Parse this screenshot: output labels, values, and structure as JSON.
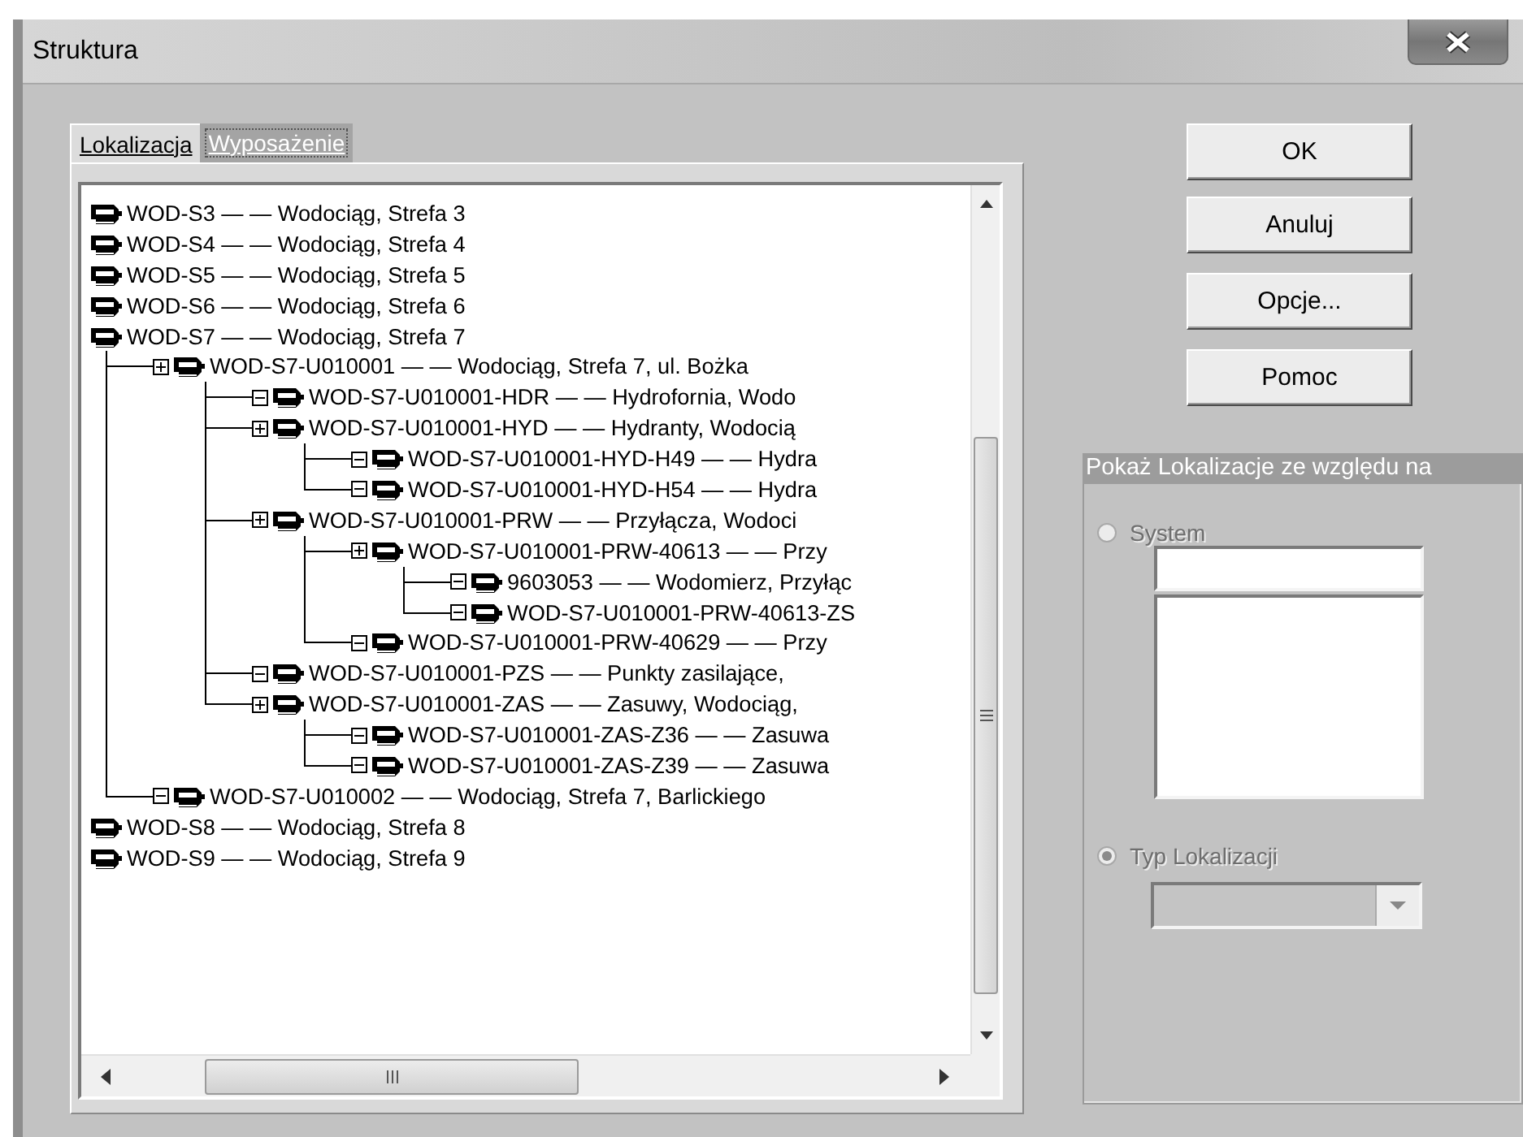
{
  "window": {
    "title": "Struktura"
  },
  "tabs": [
    {
      "label": "Lokalizacja",
      "selected": true
    },
    {
      "label": "Wyposażenie",
      "selected": false
    }
  ],
  "tree": [
    {
      "text": "WOD-S3 — — Wodociąg, Strefa 3"
    },
    {
      "text": "WOD-S4 — — Wodociąg, Strefa 4"
    },
    {
      "text": "WOD-S5 — — Wodociąg, Strefa 5"
    },
    {
      "text": "WOD-S6 — — Wodociąg, Strefa 6"
    },
    {
      "text": "WOD-S7 — — Wodociąg, Strefa 7",
      "children": [
        {
          "text": "WOD-S7-U010001 — — Wodociąg, Strefa 7, ul. Bożka",
          "expanded": false,
          "children": [
            {
              "text": "WOD-S7-U010001-HDR — — Hydrofornia, Wodo",
              "expanded": true
            },
            {
              "text": "WOD-S7-U010001-HYD — — Hydranty, Wodocią",
              "expanded": false,
              "children": [
                {
                  "text": "WOD-S7-U010001-HYD-H49 — — Hydra",
                  "expanded": true
                },
                {
                  "text": "WOD-S7-U010001-HYD-H54 — — Hydra",
                  "expanded": true
                }
              ]
            },
            {
              "text": "WOD-S7-U010001-PRW — — Przyłącza, Wodoci",
              "expanded": false,
              "children": [
                {
                  "text": "WOD-S7-U010001-PRW-40613 — — Przy",
                  "expanded": false,
                  "children": [
                    {
                      "text": "9603053 — — Wodomierz, Przyłąc",
                      "expanded": true
                    },
                    {
                      "text": "WOD-S7-U010001-PRW-40613-ZS",
                      "expanded": true
                    }
                  ]
                },
                {
                  "text": "WOD-S7-U010001-PRW-40629 — — Przy",
                  "expanded": true
                }
              ]
            },
            {
              "text": "WOD-S7-U010001-PZS — — Punkty zasilające,",
              "expanded": true
            },
            {
              "text": "WOD-S7-U010001-ZAS — — Zasuwy, Wodociąg,",
              "expanded": false,
              "children": [
                {
                  "text": "WOD-S7-U010001-ZAS-Z36 — — Zasuwa",
                  "expanded": true
                },
                {
                  "text": "WOD-S7-U010001-ZAS-Z39 — — Zasuwa",
                  "expanded": true
                }
              ]
            }
          ]
        },
        {
          "text": "WOD-S7-U010002 — — Wodociąg, Strefa 7, Barlickiego",
          "expanded": true
        }
      ]
    },
    {
      "text": "WOD-S8 — — Wodociąg, Strefa 8"
    },
    {
      "text": "WOD-S9 — — Wodociąg, Strefa 9"
    }
  ],
  "buttons": [
    "OK",
    "Anuluj",
    "Opcje...",
    "Pomoc"
  ],
  "filter_group": {
    "title": "Pokaż Lokalizacje ze względu na",
    "disabled": true,
    "options": [
      {
        "label": "System",
        "selected": false
      },
      {
        "label": "Typ Lokalizacji",
        "selected": true
      }
    ]
  }
}
